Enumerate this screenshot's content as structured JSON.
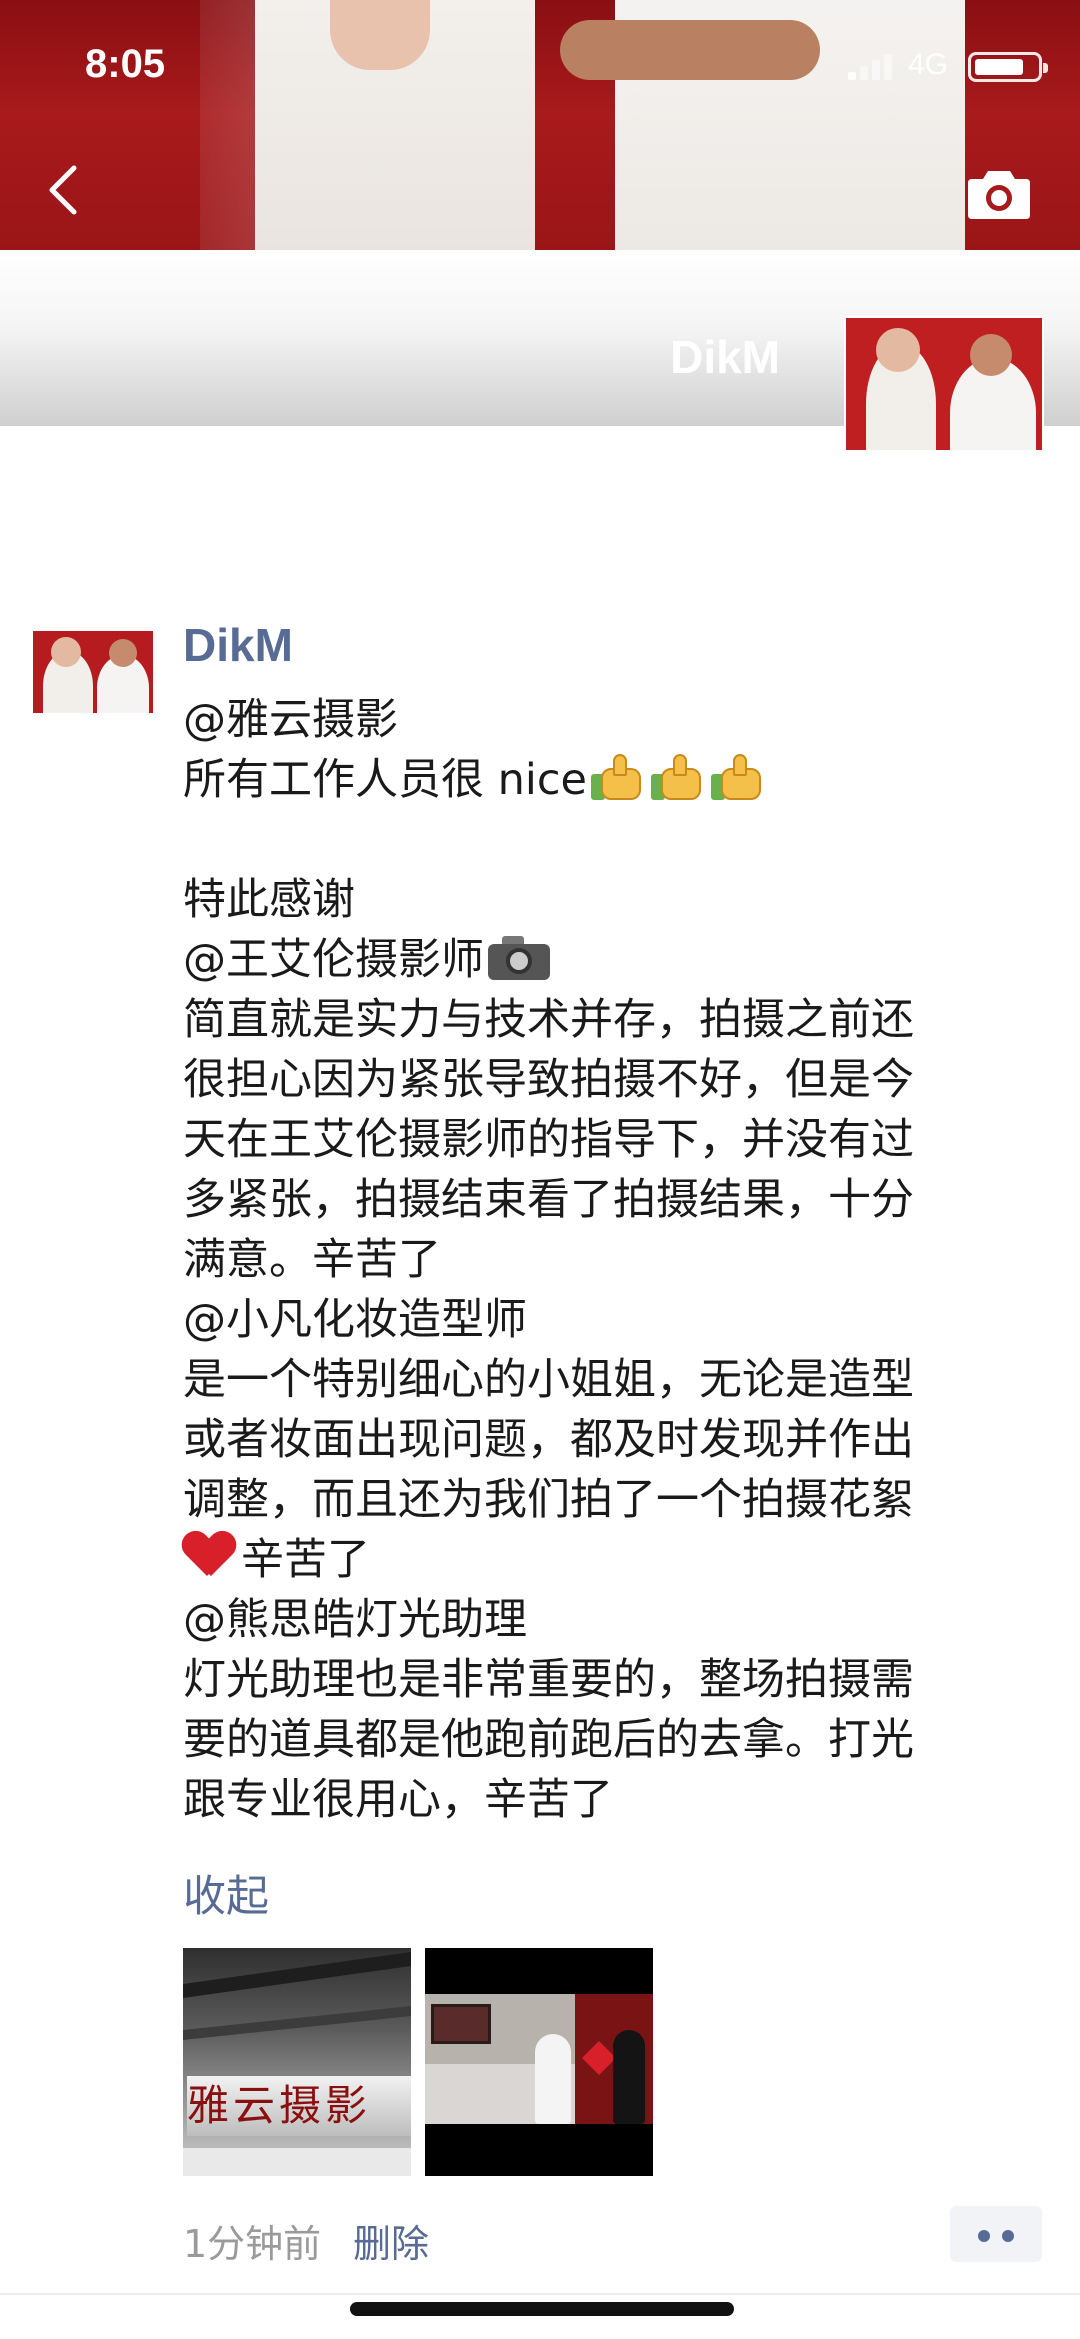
{
  "status_bar": {
    "time": "8:05",
    "network": "4G",
    "battery_level": 0.8
  },
  "nav": {
    "back_icon": "chevron-left-icon",
    "camera_icon": "camera-icon"
  },
  "cover": {
    "user_name": "DikM"
  },
  "post": {
    "author": "DikM",
    "lines": [
      "@雅云摄影",
      "所有工作人员很 nice",
      "",
      "特此感谢",
      "@王艾伦摄影师",
      "简直就是实力与技术并存，拍摄之前还",
      "很担心因为紧张导致拍摄不好，但是今",
      "天在王艾伦摄影师的指导下，并没有过",
      "多紧张，拍摄结束看了拍摄结果，十分",
      "满意。辛苦了",
      "@小凡化妆造型师",
      "是一个特别细心的小姐姐，无论是造型",
      "或者妆面出现问题，都及时发现并作出",
      "调整，而且还为我们拍了一个拍摄花絮",
      "辛苦了",
      "@熊思皓灯光助理",
      "灯光助理也是非常重要的，整场拍摄需",
      "要的道具都是他跑前跑后的去拿。打光",
      "跟专业很用心，辛苦了"
    ],
    "emojis": [
      "thumbs-up",
      "thumbs-up",
      "thumbs-up",
      "camera",
      "red-heart"
    ],
    "collapse_label": "收起",
    "photo_1_sign": "雅云摄影",
    "time_ago": "1分钟前",
    "delete_label": "删除"
  },
  "colors": {
    "link_blue": "#576b95",
    "cover_red": "#a81a1c",
    "meta_gray": "#9a9a9a"
  }
}
